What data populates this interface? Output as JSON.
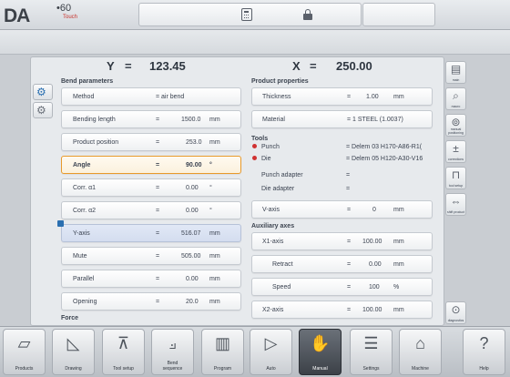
{
  "header": {
    "brand": "DA",
    "version": "•60",
    "sub": "Touch"
  },
  "axes": {
    "y_label": "Y",
    "y_eq": "=",
    "y_value": "123.45",
    "x_label": "X",
    "x_eq": "=",
    "x_value": "250.00"
  },
  "bend_parameters": {
    "title": "Bend parameters",
    "rows": [
      {
        "label": "Method",
        "eq": "= air bend",
        "value": "",
        "unit": ""
      },
      {
        "label": "Bending length",
        "eq": "=",
        "value": "1500.0",
        "unit": "mm"
      },
      {
        "label": "Product position",
        "eq": "=",
        "value": "253.0",
        "unit": "mm"
      },
      {
        "label": "Angle",
        "eq": "=",
        "value": "90.00",
        "unit": "°"
      },
      {
        "label": "Corr. α1",
        "eq": "=",
        "value": "0.00",
        "unit": "°"
      },
      {
        "label": "Corr. α2",
        "eq": "=",
        "value": "0.00",
        "unit": "°"
      },
      {
        "label": "Y-axis",
        "eq": "=",
        "value": "516.07",
        "unit": "mm"
      },
      {
        "label": "Mute",
        "eq": "=",
        "value": "505.00",
        "unit": "mm"
      },
      {
        "label": "Parallel",
        "eq": "=",
        "value": "0.00",
        "unit": "mm"
      },
      {
        "label": "Opening",
        "eq": "=",
        "value": "20.0",
        "unit": "mm"
      }
    ],
    "force_label": "Force"
  },
  "product_properties": {
    "title": "Product properties",
    "rows": [
      {
        "label": "Thickness",
        "eq": "=",
        "value": "1.00",
        "unit": "mm"
      },
      {
        "label": "Material",
        "eq": "= 1 STEEL (1.0037)",
        "value": "",
        "unit": ""
      }
    ]
  },
  "tools": {
    "title": "Tools",
    "rows": [
      {
        "label": "Punch",
        "value": "= Delem 03 H170-A86-R1("
      },
      {
        "label": "Die",
        "value": "= Delem 05 H120-A30-V16"
      },
      {
        "label": "Punch adapter",
        "value": "="
      },
      {
        "label": "Die adapter",
        "value": "="
      }
    ]
  },
  "vaxis": {
    "label": "V-axis",
    "eq": "=",
    "value": "0",
    "unit": "mm"
  },
  "auxiliary": {
    "title": "Auxiliary axes",
    "rows": [
      {
        "label": "X1-axis",
        "eq": "=",
        "value": "100.00",
        "unit": "mm"
      },
      {
        "label": "Retract",
        "eq": "=",
        "value": "0.00",
        "unit": "mm"
      },
      {
        "label": "Speed",
        "eq": "=",
        "value": "100",
        "unit": "%"
      },
      {
        "label": "X2-axis",
        "eq": "=",
        "value": "100.00",
        "unit": "mm"
      }
    ]
  },
  "right_sidebar": [
    {
      "label": "main",
      "icon": "main-view-icon",
      "glyph": "▤"
    },
    {
      "label": "macro",
      "icon": "macro-zoom-icon",
      "glyph": "⌕"
    },
    {
      "label": "manual positioning",
      "icon": "manual-positioning-icon",
      "glyph": "⊚"
    },
    {
      "label": "corrections",
      "icon": "corrections-icon",
      "glyph": "±"
    },
    {
      "label": "tool setup",
      "icon": "tool-setup-icon",
      "glyph": "⊓"
    },
    {
      "label": "shift product",
      "icon": "shift-product-icon",
      "glyph": "⇔"
    }
  ],
  "diagnostics": {
    "label": "diagnostics",
    "icon": "diagnostics-icon",
    "glyph": "⊙"
  },
  "bottom_nav": [
    {
      "label": "Products",
      "icon": "products-icon",
      "glyph": "▱"
    },
    {
      "label": "Drawing",
      "icon": "drawing-icon",
      "glyph": "◺"
    },
    {
      "label": "Tool setup",
      "icon": "tool-setup-icon",
      "glyph": "⊼"
    },
    {
      "label": "Bend\nsequence",
      "icon": "bend-sequence-icon",
      "glyph": "⟓"
    },
    {
      "label": "Program",
      "icon": "program-icon",
      "glyph": "▥"
    },
    {
      "label": "Auto",
      "icon": "auto-play-icon",
      "glyph": "▷"
    },
    {
      "label": "Manual",
      "icon": "manual-hand-icon",
      "glyph": "✋"
    },
    {
      "label": "Settings",
      "icon": "settings-icon",
      "glyph": "☰"
    },
    {
      "label": "Machine",
      "icon": "machine-icon",
      "glyph": "⌂"
    },
    {
      "label": "Help",
      "icon": "help-icon",
      "glyph": "?"
    }
  ]
}
